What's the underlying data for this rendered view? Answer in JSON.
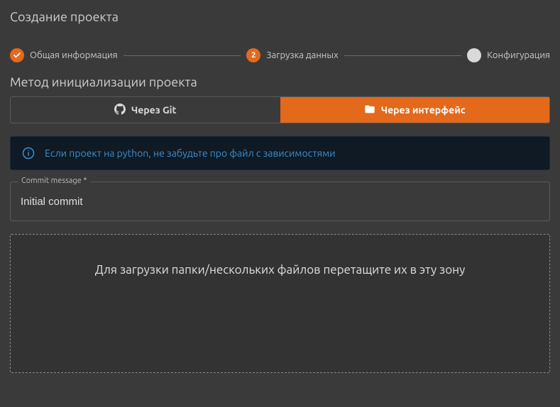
{
  "page_title": "Создание проекта",
  "stepper": {
    "steps": [
      {
        "label": "Общая информация",
        "state": "done"
      },
      {
        "label": "Загрузка данных",
        "state": "active",
        "num": "2"
      },
      {
        "label": "Конфигурация",
        "state": "pending"
      }
    ]
  },
  "init_method": {
    "title": "Метод инициализации проекта",
    "options": {
      "git": "Через Git",
      "ui": "Через интерфейс"
    }
  },
  "alert": {
    "text": "Если проект на python, не забудьте про файл с зависимостями"
  },
  "commit_field": {
    "label": "Commit message *",
    "value": "Initial commit"
  },
  "dropzone": {
    "text": "Для загрузки папки/нескольких файлов перетащите их в эту зону"
  },
  "colors": {
    "accent": "#e4691b",
    "info": "#3d8fd1"
  }
}
